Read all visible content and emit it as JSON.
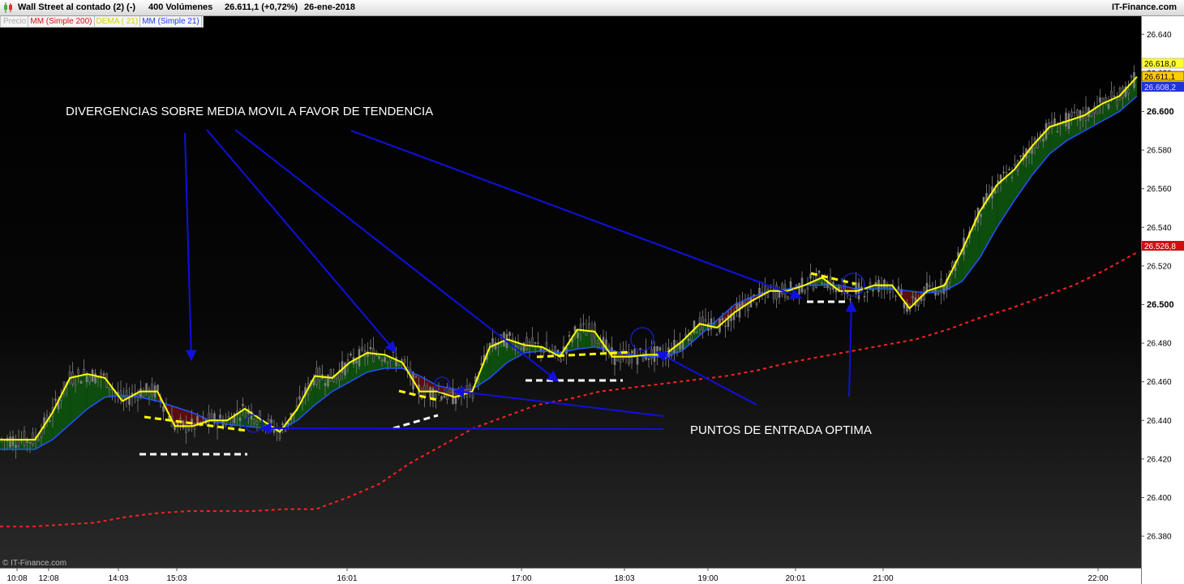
{
  "header": {
    "instrument": "Wall Street al contado (2) (-)",
    "volume": "400 Volúmenes",
    "quote": "26.611,1 (+0,72%)",
    "date": "26-ene-2018",
    "provider": "IT-Finance.com"
  },
  "legend": {
    "price": "Precio",
    "sma200": "MM (Simple 200)",
    "dema21": "DEMA ( 21)",
    "sma21": "MM (Simple 21)"
  },
  "watermark": "© IT-Finance.com",
  "badges": {
    "dema": "26.618,0",
    "last": "26.611,1",
    "sma21": "26.608,2",
    "sma200": "26.526,8"
  },
  "annotations": {
    "divergences": "DIVERGENCIAS  SOBRE MEDIA MOVIL A FAVOR DE TENDENCIA",
    "entries": "PUNTOS DE ENTRADA OPTIMA"
  },
  "colors": {
    "dema": "#ffff00",
    "sma21": "#2255ff",
    "sma200": "#ff2020",
    "bull_fill": "#0d4d0d",
    "bear_fill": "#5a0d0d",
    "arrows": "#1010dd",
    "support_white": "#ffffff",
    "trend_yellow": "#ffff00"
  },
  "chart_data": {
    "type": "line",
    "y_ticks": [
      26640,
      26620,
      26600,
      26580,
      26560,
      26540,
      26520,
      26500,
      26480,
      26460,
      26440,
      26420,
      26400,
      26380
    ],
    "ylim": [
      26367,
      26646
    ],
    "x_ticks": [
      "10:08",
      "12:08",
      "14:03",
      "15:03",
      "16:01",
      "17:00",
      "18:03",
      "19:00",
      "20:01",
      "21:00",
      "22:00"
    ],
    "grid": false,
    "series": [
      {
        "name": "DEMA ( 21)",
        "values": [
          26430,
          26430,
          26430,
          26444,
          26462,
          26464,
          26462,
          26450,
          26455,
          26455,
          26437,
          26437,
          26440,
          26440,
          26446,
          26440,
          26434,
          26446,
          26463,
          26462,
          26470,
          26475,
          26474,
          26470,
          26455,
          26455,
          26452,
          26455,
          26478,
          26482,
          26479,
          26478,
          26473,
          26487,
          26486,
          26473,
          26473,
          26474,
          26474,
          26481,
          26490,
          26488,
          26496,
          26502,
          26507,
          26507,
          26510,
          26514,
          26507,
          26507,
          26510,
          26510,
          26498,
          26507,
          26510,
          26528,
          26548,
          26562,
          26570,
          26582,
          26592,
          26595,
          26598,
          26604,
          26608,
          26618
        ]
      },
      {
        "name": "MM (Simple 21)",
        "values": [
          26425,
          26425,
          26425,
          26430,
          26438,
          26446,
          26452,
          26453,
          26452,
          26450,
          26447,
          26444,
          26440,
          26438,
          26437,
          26436,
          26435,
          26440,
          26448,
          26455,
          26460,
          26465,
          26467,
          26467,
          26463,
          26458,
          26456,
          26456,
          26462,
          26470,
          26475,
          26476,
          26475,
          26477,
          26478,
          26476,
          26474,
          26473,
          26473,
          26476,
          26484,
          26492,
          26500,
          26504,
          26507,
          26508,
          26510,
          26510,
          26510,
          26508,
          26508,
          26508,
          26507,
          26506,
          26507,
          26512,
          26524,
          26540,
          26554,
          26567,
          26578,
          26585,
          26590,
          26595,
          26600,
          26608
        ]
      },
      {
        "name": "MM (Simple 200)",
        "values": [
          26385,
          26385,
          26386,
          26387,
          26390,
          26392,
          26393,
          26393,
          26393,
          26394,
          26394,
          26400,
          26407,
          26418,
          26427,
          26436,
          26442,
          26448,
          26451,
          26455,
          26457,
          26459,
          26461,
          26463,
          26466,
          26470,
          26473,
          26476,
          26479,
          26482,
          26487,
          26493,
          26498,
          26504,
          26510,
          26518,
          26527
        ]
      }
    ]
  }
}
